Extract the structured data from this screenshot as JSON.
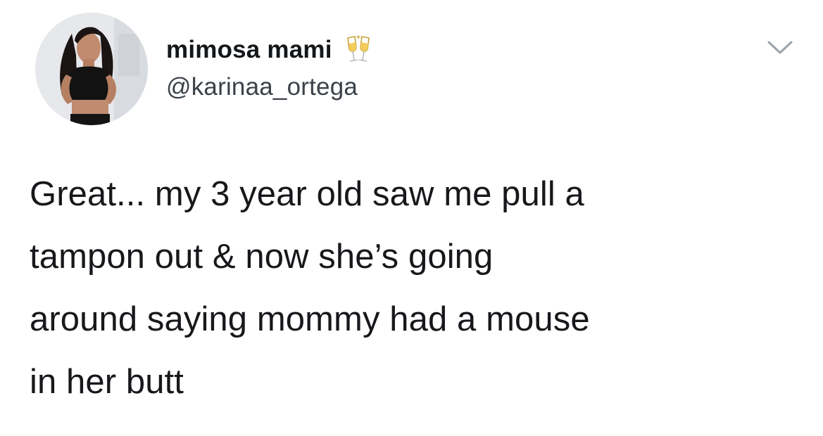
{
  "author": {
    "display_name": "mimosa mami",
    "name_emoji_icon": "clinking-glasses-icon",
    "handle": "@karinaa_ortega"
  },
  "tweet": {
    "lines": [
      "Great... my 3 year old saw me pull a",
      "tampon out & now she’s going",
      "around saying mommy had a mouse",
      "in her butt"
    ]
  },
  "controls": {
    "menu_icon": "chevron-down-icon"
  },
  "colors": {
    "text_primary": "#14171a",
    "text_secondary": "#3a4148",
    "background": "#ffffff",
    "chevron": "#9aa3ab"
  }
}
